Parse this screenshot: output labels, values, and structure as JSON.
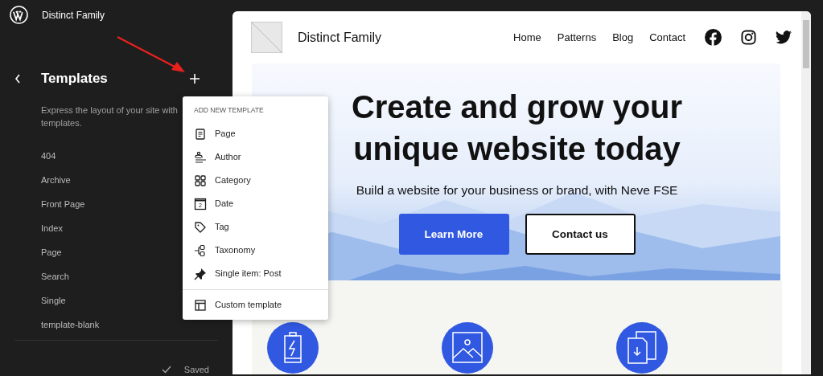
{
  "site_name": "Distinct Family",
  "sidebar": {
    "title": "Templates",
    "description": "Express the layout of your site with templates.",
    "templates": [
      "404",
      "Archive",
      "Front Page",
      "Index",
      "Page",
      "Search",
      "Single",
      "template-blank"
    ],
    "status": "Saved"
  },
  "menu": {
    "heading": "ADD NEW TEMPLATE",
    "items": [
      {
        "kind": "page",
        "label": "Page"
      },
      {
        "kind": "author",
        "label": "Author"
      },
      {
        "kind": "category",
        "label": "Category"
      },
      {
        "kind": "date",
        "label": "Date",
        "icon_text": "2"
      },
      {
        "kind": "tag",
        "label": "Tag"
      },
      {
        "kind": "taxonomy",
        "label": "Taxonomy"
      },
      {
        "kind": "pin",
        "label": "Single item: Post"
      }
    ],
    "footer_item": {
      "kind": "custom",
      "label": "Custom template"
    }
  },
  "preview": {
    "site_title": "Distinct Family",
    "nav": [
      "Home",
      "Patterns",
      "Blog",
      "Contact"
    ],
    "hero_title": "Create and grow your unique website today",
    "hero_subtitle": "Build a website for your business or brand, with Neve FSE",
    "buttons": [
      {
        "kind": "primary",
        "label": "Learn More"
      },
      {
        "kind": "outline",
        "label": "Contact us"
      }
    ]
  }
}
